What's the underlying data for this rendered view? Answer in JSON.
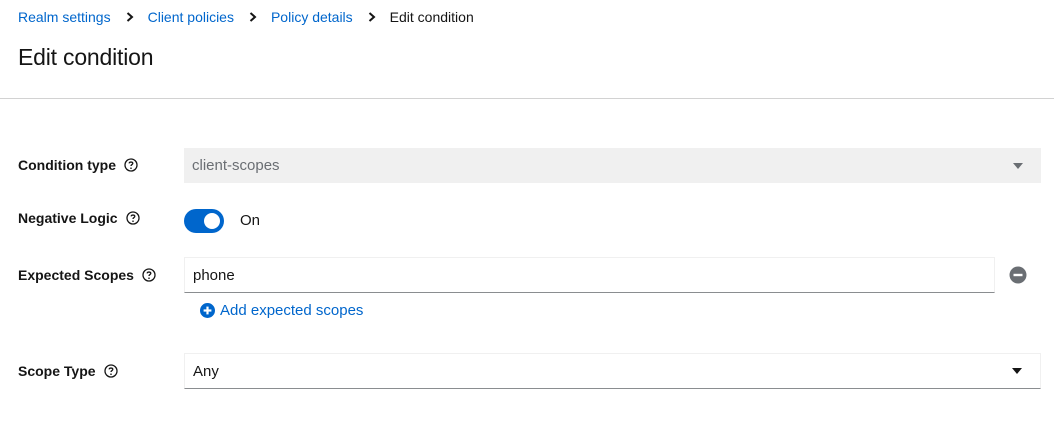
{
  "breadcrumb": {
    "items": [
      {
        "label": "Realm settings"
      },
      {
        "label": "Client policies"
      },
      {
        "label": "Policy details"
      }
    ],
    "current": "Edit condition"
  },
  "page_title": "Edit condition",
  "form": {
    "condition_type": {
      "label": "Condition type",
      "value": "client-scopes"
    },
    "negative_logic": {
      "label": "Negative Logic",
      "state": "On"
    },
    "expected_scopes": {
      "label": "Expected Scopes",
      "value": "phone",
      "add_label": "Add expected scopes"
    },
    "scope_type": {
      "label": "Scope Type",
      "value": "Any"
    }
  },
  "colors": {
    "link": "#0066cc",
    "toggle_on": "#0066cc",
    "disabled_bg": "#f0f0f0",
    "text": "#151515"
  }
}
